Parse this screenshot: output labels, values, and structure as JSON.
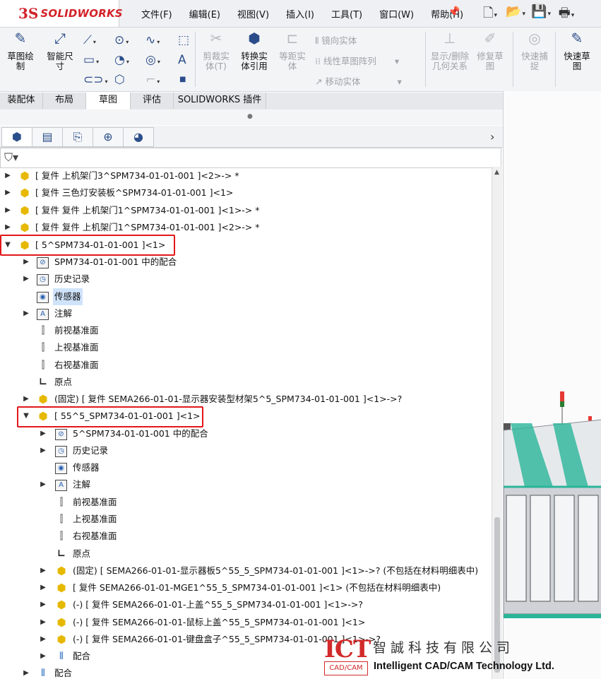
{
  "app": {
    "logo_ds": "3S",
    "logo_text": "SOLIDWORKS"
  },
  "menu": [
    "文件(F)",
    "编辑(E)",
    "视图(V)",
    "插入(I)",
    "工具(T)",
    "窗口(W)",
    "帮助(H)"
  ],
  "ribbon": {
    "sketch": "草图绘\n制",
    "smart_dim": "智能尺\n寸",
    "trim": "剪裁实\n体(T)",
    "convert": "转换实\n体引用",
    "offset": "等距实\n体",
    "mirror": "镜向实体",
    "linear_pattern": "线性草图阵列",
    "move": "移动实体",
    "show_relations": "显示/删除\n几何关系",
    "repair": "修复草\n图",
    "quick_snap": "快速捕\n捉",
    "rapid_sketch": "快速草\n图"
  },
  "tabs": [
    "装配体",
    "布局",
    "草图",
    "评估",
    "SOLIDWORKS 插件"
  ],
  "tree": {
    "rows": [
      "[ 复件 上机架门3^SPM734-01-01-001 ]<2>-> *",
      "[ 复件 三色灯安装板^SPM734-01-01-001 ]<1>",
      "[ 复件 复件 上机架门1^SPM734-01-01-001 ]<1>-> *",
      "[ 复件 复件 上机架门1^SPM734-01-01-001 ]<2>-> *",
      "[ 5^SPM734-01-01-001 ]<1>",
      "SPM734-01-01-001 中的配合",
      "历史记录",
      "传感器",
      "注解",
      "前视基准面",
      "上视基准面",
      "右视基准面",
      "原点",
      "(固定) [ 复件 SEMA266-01-01-显示器安装型材架5^5_SPM734-01-01-001 ]<1>->?",
      "[ 55^5_SPM734-01-01-001 ]<1>",
      "5^SPM734-01-01-001 中的配合",
      "历史记录",
      "传感器",
      "注解",
      "前视基准面",
      "上视基准面",
      "右视基准面",
      "原点",
      "(固定) [ SEMA266-01-01-显示器板5^55_5_SPM734-01-01-001 ]<1>->? (不包括在材料明细表中)",
      "[ 复件 SEMA266-01-01-MGE1^55_5_SPM734-01-01-001 ]<1> (不包括在材料明细表中)",
      "(-) [ 复件 SEMA266-01-01-上盖^55_5_SPM734-01-01-001 ]<1>->?",
      "(-) [ 复件 SEMA266-01-01-鼠标上盖^55_5_SPM734-01-01-001 ]<1>",
      "(-) [ 复件 SEMA266-01-01-键盘盒子^55_5_SPM734-01-01-001 ]<1>->?",
      "配合",
      "配合"
    ]
  },
  "watermark": {
    "ict": "ICT",
    "cadcam": "CAD/CAM",
    "cn": "智誠科技有限公司",
    "en": "Intelligent CAD/CAM Technology Ltd."
  }
}
